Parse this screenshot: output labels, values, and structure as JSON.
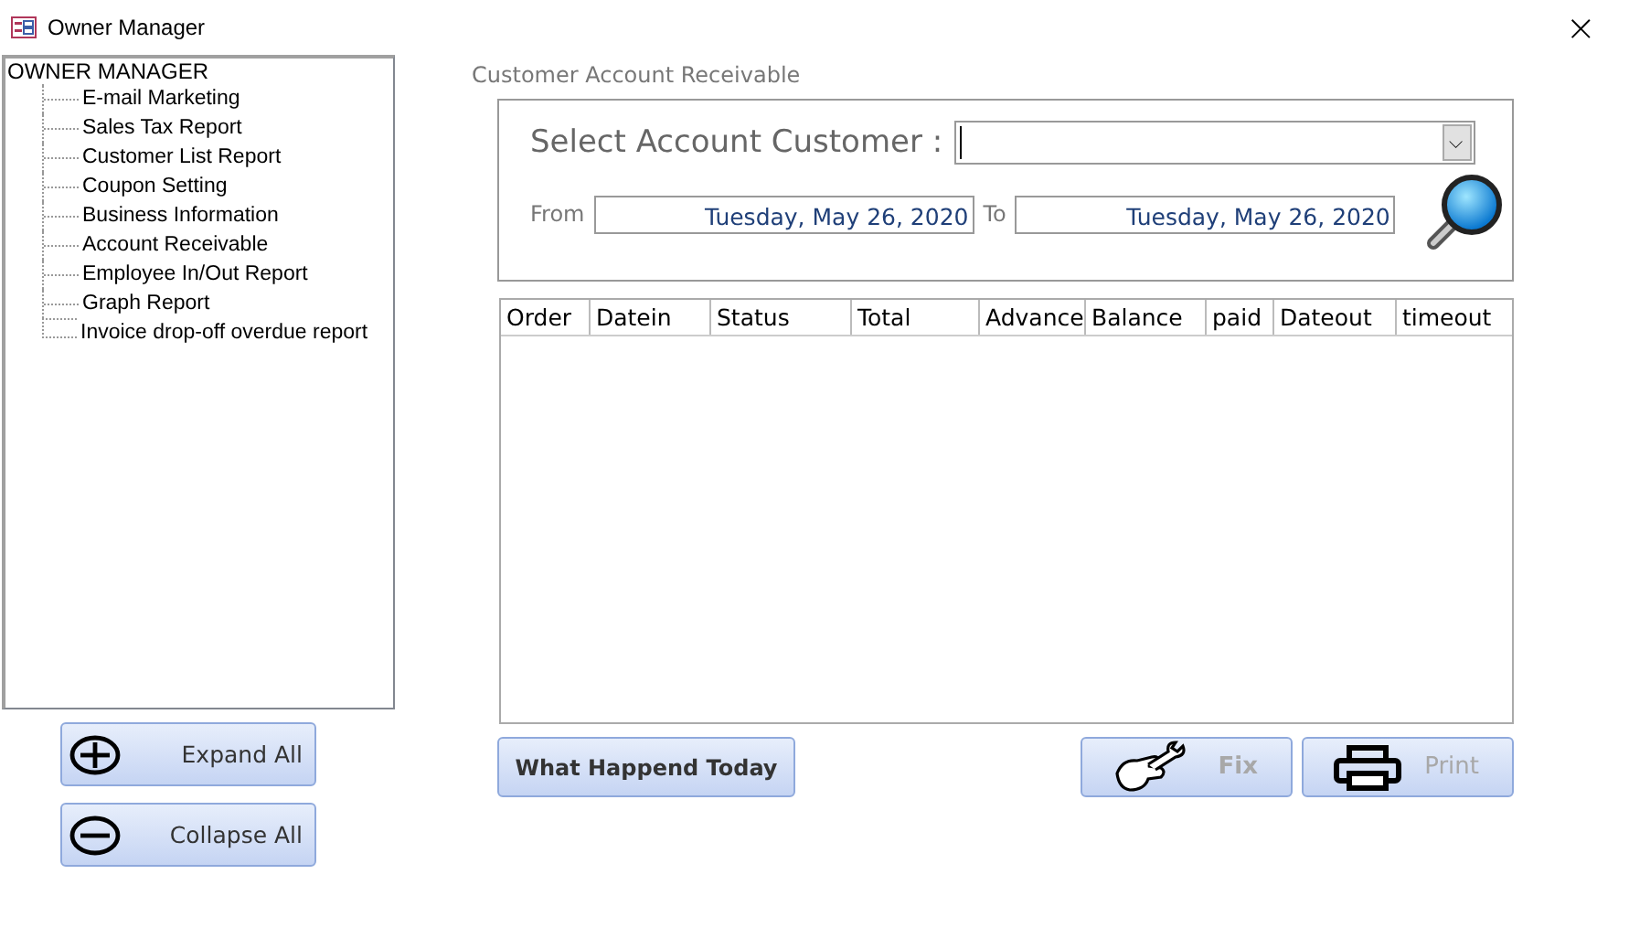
{
  "window": {
    "title": "Owner Manager",
    "close": "×"
  },
  "tree": {
    "label": "OWNER MANAGER",
    "children": [
      {
        "label": "E-mail Marketing"
      },
      {
        "label": "Sales Tax Report"
      },
      {
        "label": "Customer List Report"
      },
      {
        "label": "Coupon Setting"
      },
      {
        "label": "Business Information"
      },
      {
        "label": "Account Receivable"
      },
      {
        "label": "Employee In/Out Report"
      },
      {
        "label": "Graph Report"
      },
      {
        "label": "Invoice drop-off overdue report"
      }
    ]
  },
  "tree_buttons": [
    {
      "kind": "expand",
      "label": "Expand All"
    },
    {
      "kind": "collapse",
      "label": "Collapse All"
    }
  ],
  "form": {
    "title": "Customer Account Receivable",
    "customer": {
      "label": "Select Account Customer :",
      "dropdown_arrow": "⌵"
    },
    "from": {
      "label": "From",
      "value": "Tuesday, May 26, 2020"
    },
    "to": {
      "label": "To",
      "value": "Tuesday, May 26, 2020"
    }
  },
  "table": {
    "columns": [
      "Order",
      "Datein",
      "Status",
      "Total",
      "Advance",
      "Balance",
      "paid",
      "Dateout",
      "timeout"
    ]
  },
  "buttons": [
    {
      "kind": "text",
      "label": "What Happend Today",
      "disabled": false
    },
    {
      "kind": "fix",
      "label": "Fix",
      "disabled": true
    },
    {
      "kind": "print",
      "label": "Print",
      "disabled": true
    }
  ]
}
